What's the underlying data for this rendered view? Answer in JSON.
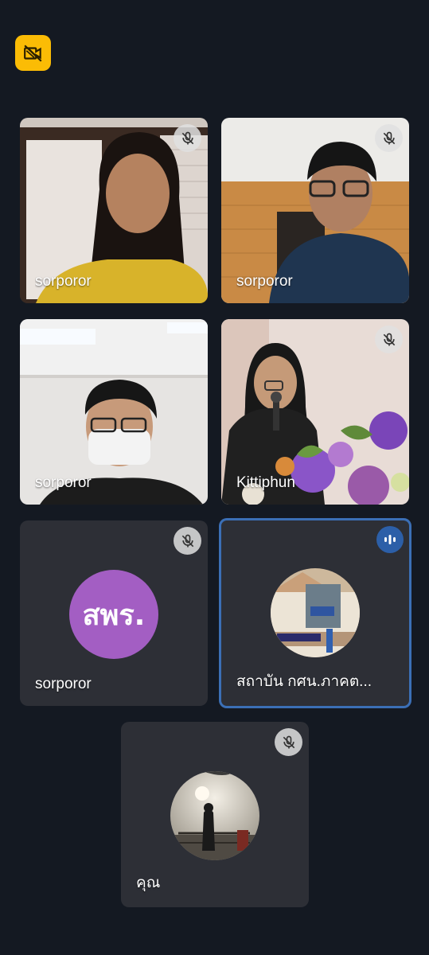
{
  "toolbar": {
    "camera_icon": "camera-off-icon",
    "accent": "#fbbc05"
  },
  "participants": [
    {
      "name": "sorporor",
      "muted": true
    },
    {
      "name": "sorporor",
      "muted": true
    },
    {
      "name": "sorporor",
      "muted": false
    },
    {
      "name": "Kittiphun",
      "muted": true
    },
    {
      "name": "sorporor",
      "muted": true,
      "initials": "สพร."
    },
    {
      "name": "สถาบัน กศน.ภาคต...",
      "muted": false,
      "speaking": true
    },
    {
      "name": "คุณ",
      "muted": true
    }
  ],
  "colors": {
    "background": "#141922",
    "tile": "#2d2f36",
    "speaking_border": "#3b6fb6",
    "initials_bg": "#a35ec3"
  }
}
